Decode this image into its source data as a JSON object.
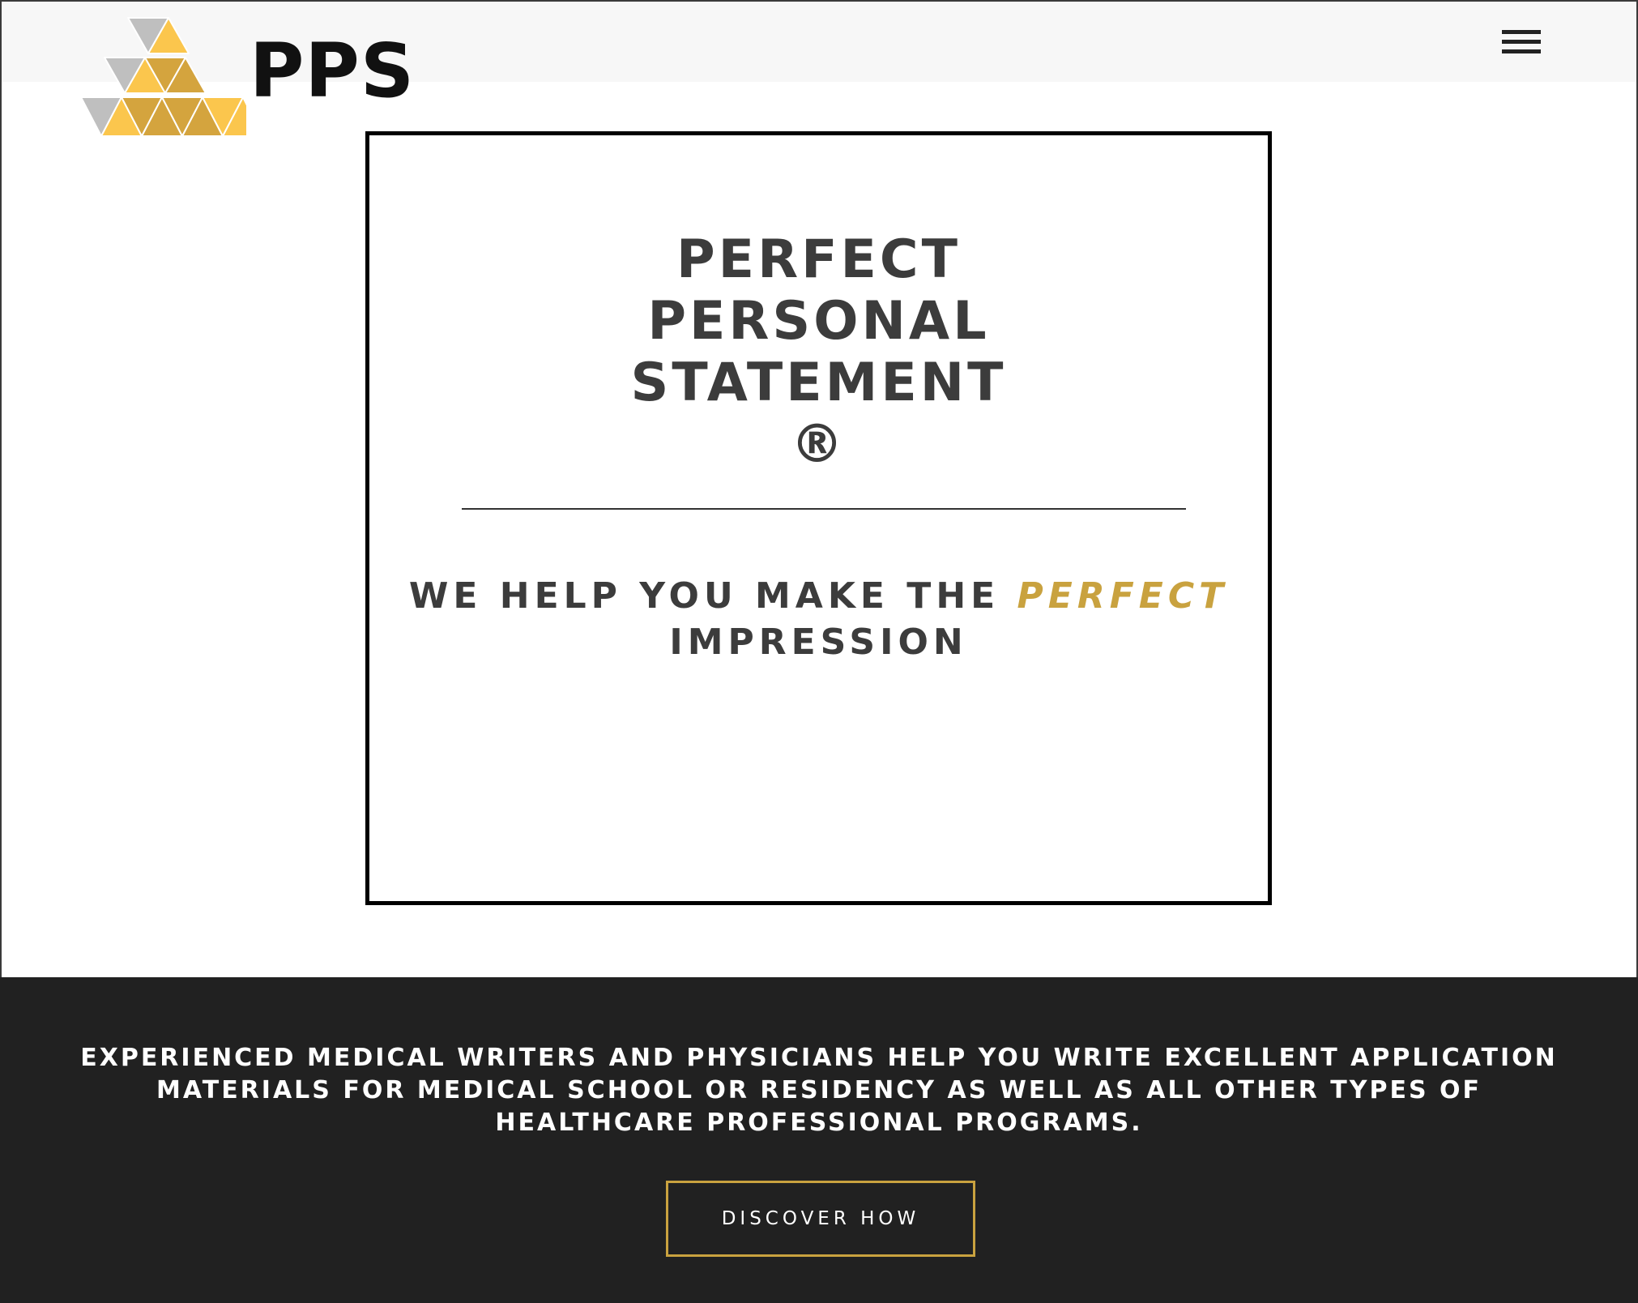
{
  "brand": {
    "name": "PPS",
    "colors": {
      "gold": "#c9a23f",
      "yellow": "#fbc64d",
      "gray": "#bfbfbf",
      "dark": "#212121"
    }
  },
  "header": {
    "menu_icon": "hamburger-menu-icon"
  },
  "hero": {
    "title_lines": [
      "PERFECT",
      "PERSONAL",
      "STATEMENT",
      "®"
    ],
    "tagline_prefix": "WE HELP YOU MAKE THE",
    "tagline_accent": "PERFECT",
    "tagline_suffix": "IMPRESSION"
  },
  "intro": {
    "text": "EXPERIENCED MEDICAL WRITERS AND PHYSICIANS HELP YOU WRITE EXCELLENT APPLICATION MATERIALS FOR MEDICAL SCHOOL OR RESIDENCY AS WELL AS ALL OTHER TYPES OF HEALTHCARE PROFESSIONAL PROGRAMS.",
    "button_label": "DISCOVER HOW"
  }
}
